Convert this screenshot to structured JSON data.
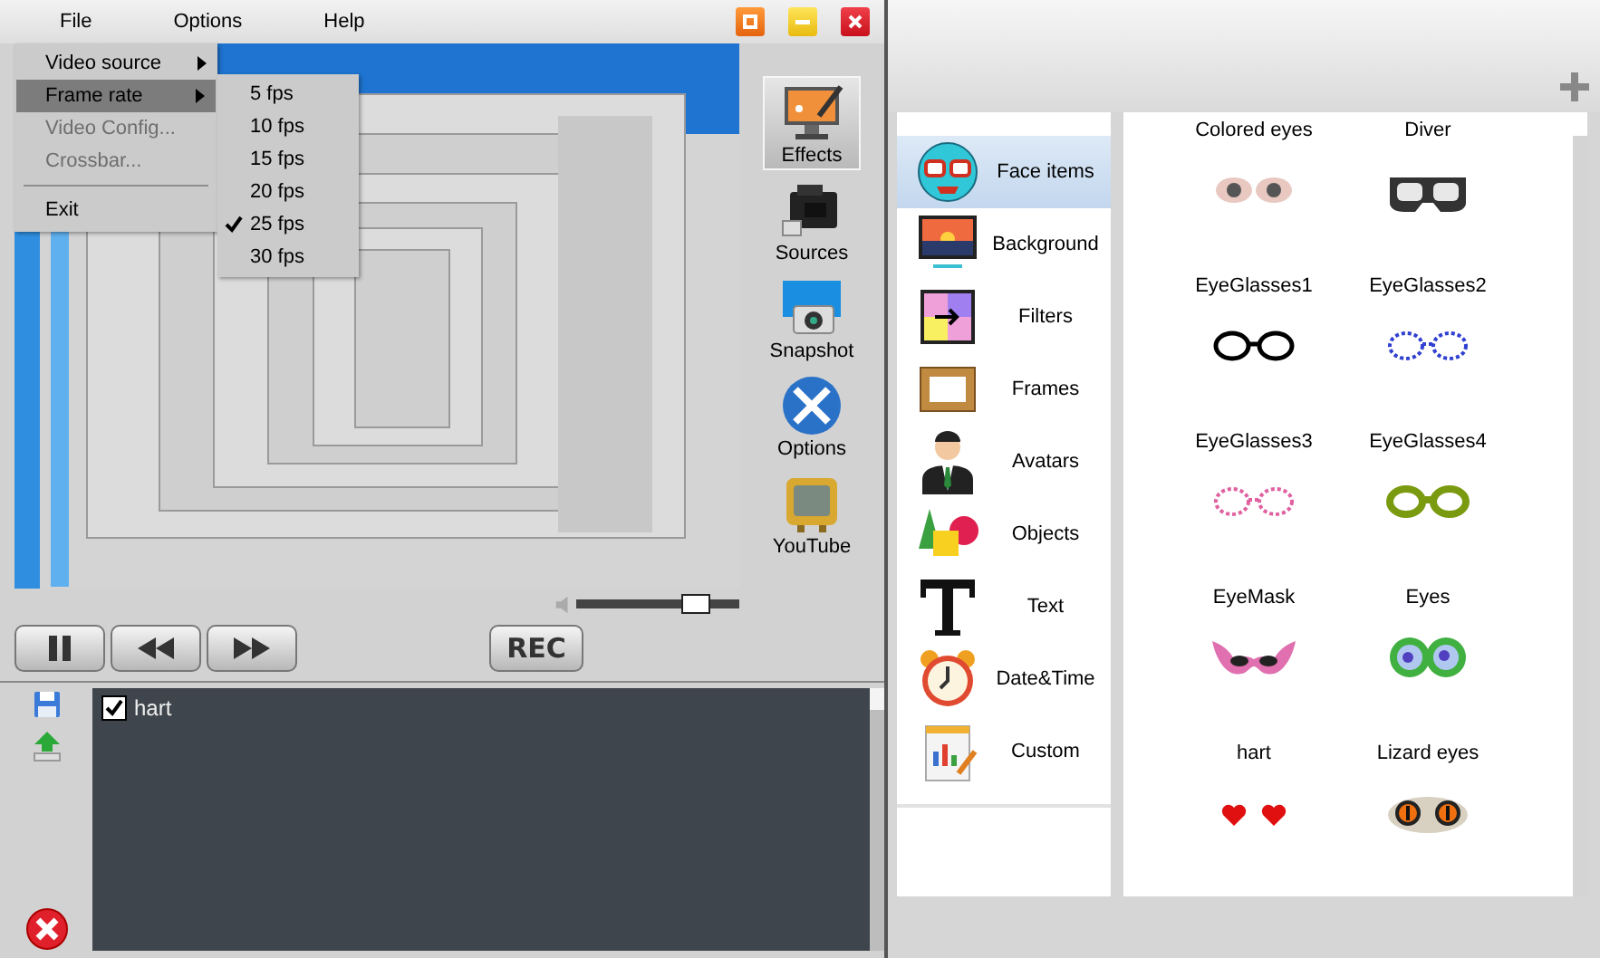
{
  "menubar": [
    {
      "label": "File"
    },
    {
      "label": "Options"
    },
    {
      "label": "Help"
    }
  ],
  "file_menu": [
    {
      "kind": "submenu",
      "label": "Video source",
      "selected": false,
      "disabled": false
    },
    {
      "kind": "submenu",
      "label": "Frame rate",
      "selected": true,
      "disabled": false
    },
    {
      "kind": "item",
      "label": "Video Config...",
      "selected": false,
      "disabled": true
    },
    {
      "kind": "item",
      "label": "Crossbar...",
      "selected": false,
      "disabled": true
    },
    {
      "kind": "separator"
    },
    {
      "kind": "item",
      "label": "Exit",
      "selected": false,
      "disabled": false
    }
  ],
  "frame_rate_menu": [
    {
      "label": "5 fps",
      "checked": false
    },
    {
      "label": "10 fps",
      "checked": false
    },
    {
      "label": "15 fps",
      "checked": false
    },
    {
      "label": "20 fps",
      "checked": false
    },
    {
      "label": "25 fps",
      "checked": true
    },
    {
      "label": "30 fps",
      "checked": false
    }
  ],
  "volume": {
    "level": 0.75
  },
  "toolbar": [
    {
      "label": "Effects",
      "selected": true
    },
    {
      "label": "Sources",
      "selected": false
    },
    {
      "label": "Snapshot",
      "selected": false
    },
    {
      "label": "Options",
      "selected": false
    },
    {
      "label": "YouTube",
      "selected": false
    }
  ],
  "record_button": {
    "label": "REC"
  },
  "active_effects": [
    {
      "label": "hart",
      "checked": true
    }
  ],
  "categories": [
    {
      "label": "Face items",
      "selected": true
    },
    {
      "label": "Background",
      "selected": false
    },
    {
      "label": "Filters",
      "selected": false
    },
    {
      "label": "Frames",
      "selected": false
    },
    {
      "label": "Avatars",
      "selected": false
    },
    {
      "label": "Objects",
      "selected": false
    },
    {
      "label": "Text",
      "selected": false
    },
    {
      "label": "Date&Time",
      "selected": false
    },
    {
      "label": "Custom",
      "selected": false
    }
  ],
  "items": [
    {
      "label": "Colored eyes"
    },
    {
      "label": "Diver"
    },
    {
      "label": "EyeGlasses1"
    },
    {
      "label": "EyeGlasses2"
    },
    {
      "label": "EyeGlasses3"
    },
    {
      "label": "EyeGlasses4"
    },
    {
      "label": "EyeMask"
    },
    {
      "label": "Eyes"
    },
    {
      "label": "hart"
    },
    {
      "label": "Lizard eyes"
    }
  ]
}
